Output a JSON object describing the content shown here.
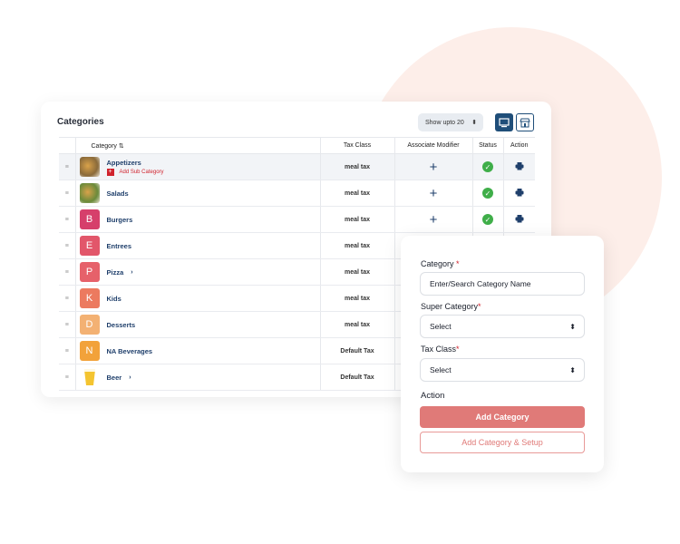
{
  "categories_panel": {
    "title": "Categories",
    "show_select": "Show upto 20",
    "view_buttons": [
      {
        "icon": "desktop-icon",
        "active": true
      },
      {
        "icon": "store-icon",
        "active": false
      }
    ],
    "columns": [
      "Category",
      "Tax Class",
      "Associate Modifier",
      "Status",
      "Action"
    ],
    "rows": [
      {
        "name": "Appetizers",
        "thumb": "image",
        "letter": "",
        "color": "#8a6a3a",
        "tax": "meal tax",
        "sub_link": "Add Sub Category",
        "chevron": false,
        "has_actions": true,
        "highlight": true
      },
      {
        "name": "Salads",
        "thumb": "image",
        "letter": "",
        "color": "#6a8a3a",
        "tax": "meal tax",
        "sub_link": "",
        "chevron": false,
        "has_actions": true,
        "highlight": false
      },
      {
        "name": "Burgers",
        "thumb": "letter",
        "letter": "B",
        "color": "#d63f6b",
        "tax": "meal tax",
        "sub_link": "",
        "chevron": false,
        "has_actions": true,
        "highlight": false
      },
      {
        "name": "Entrees",
        "thumb": "letter",
        "letter": "E",
        "color": "#e2566a",
        "tax": "meal tax",
        "sub_link": "",
        "chevron": false,
        "has_actions": false,
        "highlight": false
      },
      {
        "name": "Pizza",
        "thumb": "letter",
        "letter": "P",
        "color": "#e6616a",
        "tax": "meal tax",
        "sub_link": "",
        "chevron": true,
        "has_actions": false,
        "highlight": false
      },
      {
        "name": "Kids",
        "thumb": "letter",
        "letter": "K",
        "color": "#ec7a5f",
        "tax": "meal tax",
        "sub_link": "",
        "chevron": false,
        "has_actions": false,
        "highlight": false
      },
      {
        "name": "Desserts",
        "thumb": "letter",
        "letter": "D",
        "color": "#f3b173",
        "tax": "meal tax",
        "sub_link": "",
        "chevron": false,
        "has_actions": false,
        "highlight": false
      },
      {
        "name": "NA Beverages",
        "thumb": "letter",
        "letter": "N",
        "color": "#f2a23a",
        "tax": "Default Tax",
        "sub_link": "",
        "chevron": false,
        "has_actions": false,
        "highlight": false
      },
      {
        "name": "Beer",
        "thumb": "beer",
        "letter": "",
        "color": "#f4c430",
        "tax": "Default Tax",
        "sub_link": "",
        "chevron": true,
        "has_actions": false,
        "highlight": false
      }
    ]
  },
  "form": {
    "category_label": "Category",
    "category_placeholder": "Enter/Search Category Name",
    "super_category_label": "Super Category",
    "super_category_value": "Select",
    "tax_class_label": "Tax Class",
    "tax_class_value": "Select",
    "required_mark": "*",
    "action_label": "Action",
    "add_button": "Add Category",
    "add_setup_button": "Add Category & Setup"
  },
  "colors": {
    "accent": "#e07a78",
    "navy": "#1f3f6b",
    "status_green": "#3fae49",
    "bg_circle": "#fdeee9"
  }
}
